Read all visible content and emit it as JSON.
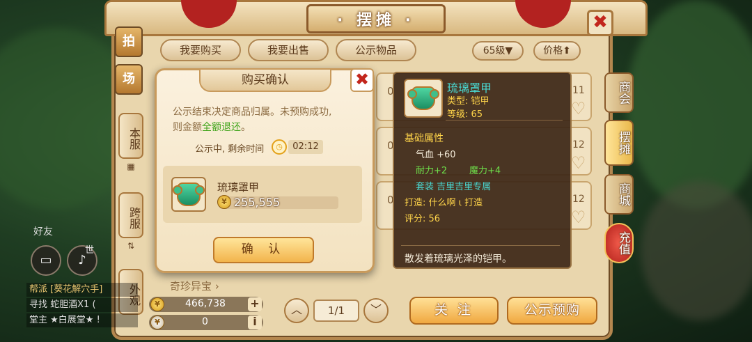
{
  "stall": {
    "title": "· 摆摊 ·",
    "close_glyph": "✖",
    "tabs": [
      "我要购买",
      "我要出售",
      "公示物品"
    ],
    "level_filter": "65级▼",
    "price_sort": "价格⬆"
  },
  "left_tabs": {
    "seal_1": "拍",
    "seal_2": "场",
    "local_server": "本服",
    "cross_server": "跨服",
    "appearance": "外观",
    "rare_items": "奇珍异宝 ›"
  },
  "right_tabs": [
    "商会",
    "摆摊",
    "商城",
    "充值"
  ],
  "listings": [
    {
      "left": "0",
      "right": "11"
    },
    {
      "left": "0",
      "right": "12"
    },
    {
      "left": "0",
      "right": "12"
    }
  ],
  "currency": {
    "gold_value": "466,738",
    "silver_value": "0",
    "add_glyph": "+",
    "info_glyph": "i"
  },
  "pager": {
    "prev": "︿",
    "next": "﹀",
    "page": "1/1"
  },
  "actions": {
    "follow": "关 注",
    "public_preorder": "公示预购"
  },
  "side_ui": {
    "friends": "好友",
    "chat_lines": [
      "帮派 [葵花解穴手]",
      "寻找 蛇胆酒X1 (",
      "堂主 ★白展堂★ !"
    ],
    "world_label": "世"
  },
  "dialog": {
    "title": "购买确认",
    "close_glyph": "✖",
    "message_line1": "公示结束决定商品归属。未预购成功,",
    "message_line2_prefix": "则金额",
    "message_line2_highlight": "全额退还",
    "message_line2_suffix": "。",
    "timer_label": "公示中, 剩余时间",
    "timer_value": "02:12",
    "item_name": "琉璃罩甲",
    "price": "255,555",
    "confirm": "确 认"
  },
  "tooltip": {
    "name": "琉璃罩甲",
    "type_line": "类型: 铠甲",
    "level_line": "等级: 65",
    "base_attr_header": "基础属性",
    "hp_line": "气血 +60",
    "endurance": "耐力+2",
    "magic": "魔力+4",
    "set_line": "套装 吉里吉里专属",
    "forge_line": "打造: 什么啊 ι  打造",
    "score_line": "评分: 56",
    "description": "散发着琉璃光泽的铠甲。"
  },
  "colors": {
    "panel": "#e9d6ad",
    "accent_red": "#c2261d",
    "highlight_green": "#3ea318",
    "tooltip_cyan": "#49d9d3",
    "tooltip_yellow": "#ffd54a"
  }
}
